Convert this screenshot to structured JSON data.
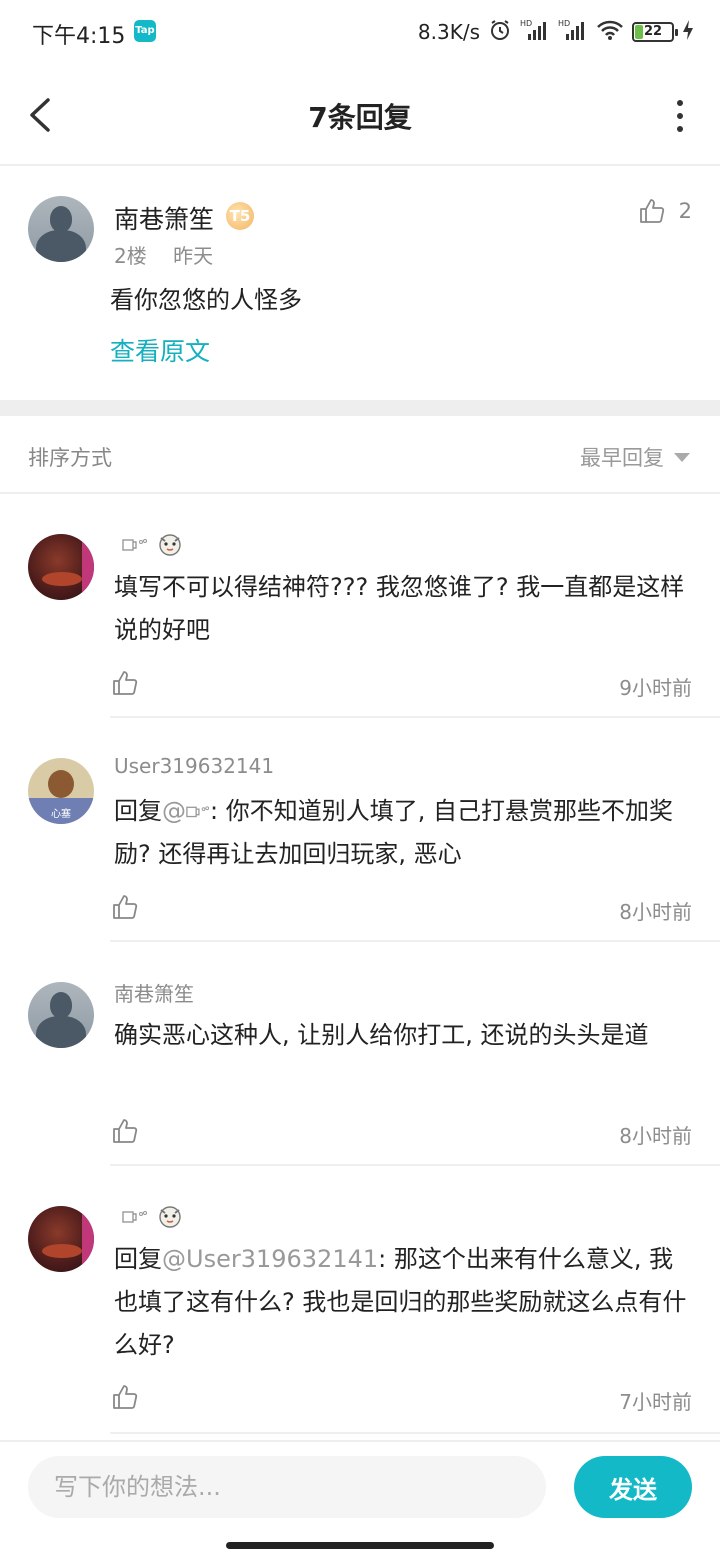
{
  "status_bar": {
    "time": "下午4:15",
    "app_badge": "Tap",
    "net_speed": "8.3K/s",
    "battery_level": "22",
    "battery_fraction": 0.22
  },
  "header": {
    "title": "7条回复"
  },
  "original_post": {
    "author": "南巷箫笙",
    "level_badge": "T5",
    "floor": "2楼",
    "time": "昨天",
    "text": "看你忽悠的人怪多",
    "like_count": "2",
    "view_original": "查看原文"
  },
  "sort": {
    "label": "排序方式",
    "selected": "最早回复"
  },
  "replies": [
    {
      "author": "",
      "text_prefix": "",
      "mention": "",
      "text": "填写不可以得结神符??? 我忽悠谁了? 我一直都是这样说的好吧",
      "time": "9小时前"
    },
    {
      "author": "User319632141",
      "text_prefix": "回复",
      "mention": "@",
      "text": ": 你不知道别人填了, 自己打悬赏那些不加奖励? 还得再让去加回归玩家, 恶心",
      "time": "8小时前",
      "avatar_caption": "心塞"
    },
    {
      "author": "南巷箫笙",
      "text_prefix": "",
      "mention": "",
      "text": "确实恶心这种人, 让别人给你打工, 还说的头头是道",
      "time": "8小时前"
    },
    {
      "author": "",
      "text_prefix": "回复",
      "mention": "@User319632141",
      "text": ": 那这个出来有什么意义, 我也填了这有什么? 我也是回归的那些奖励就这么点有什么好?",
      "time": "7小时前"
    }
  ],
  "composer": {
    "placeholder": "写下你的想法...",
    "send_label": "发送"
  },
  "colors": {
    "accent": "#14b9c8",
    "link": "#14b0c0",
    "muted_text": "#8c8c8c"
  }
}
